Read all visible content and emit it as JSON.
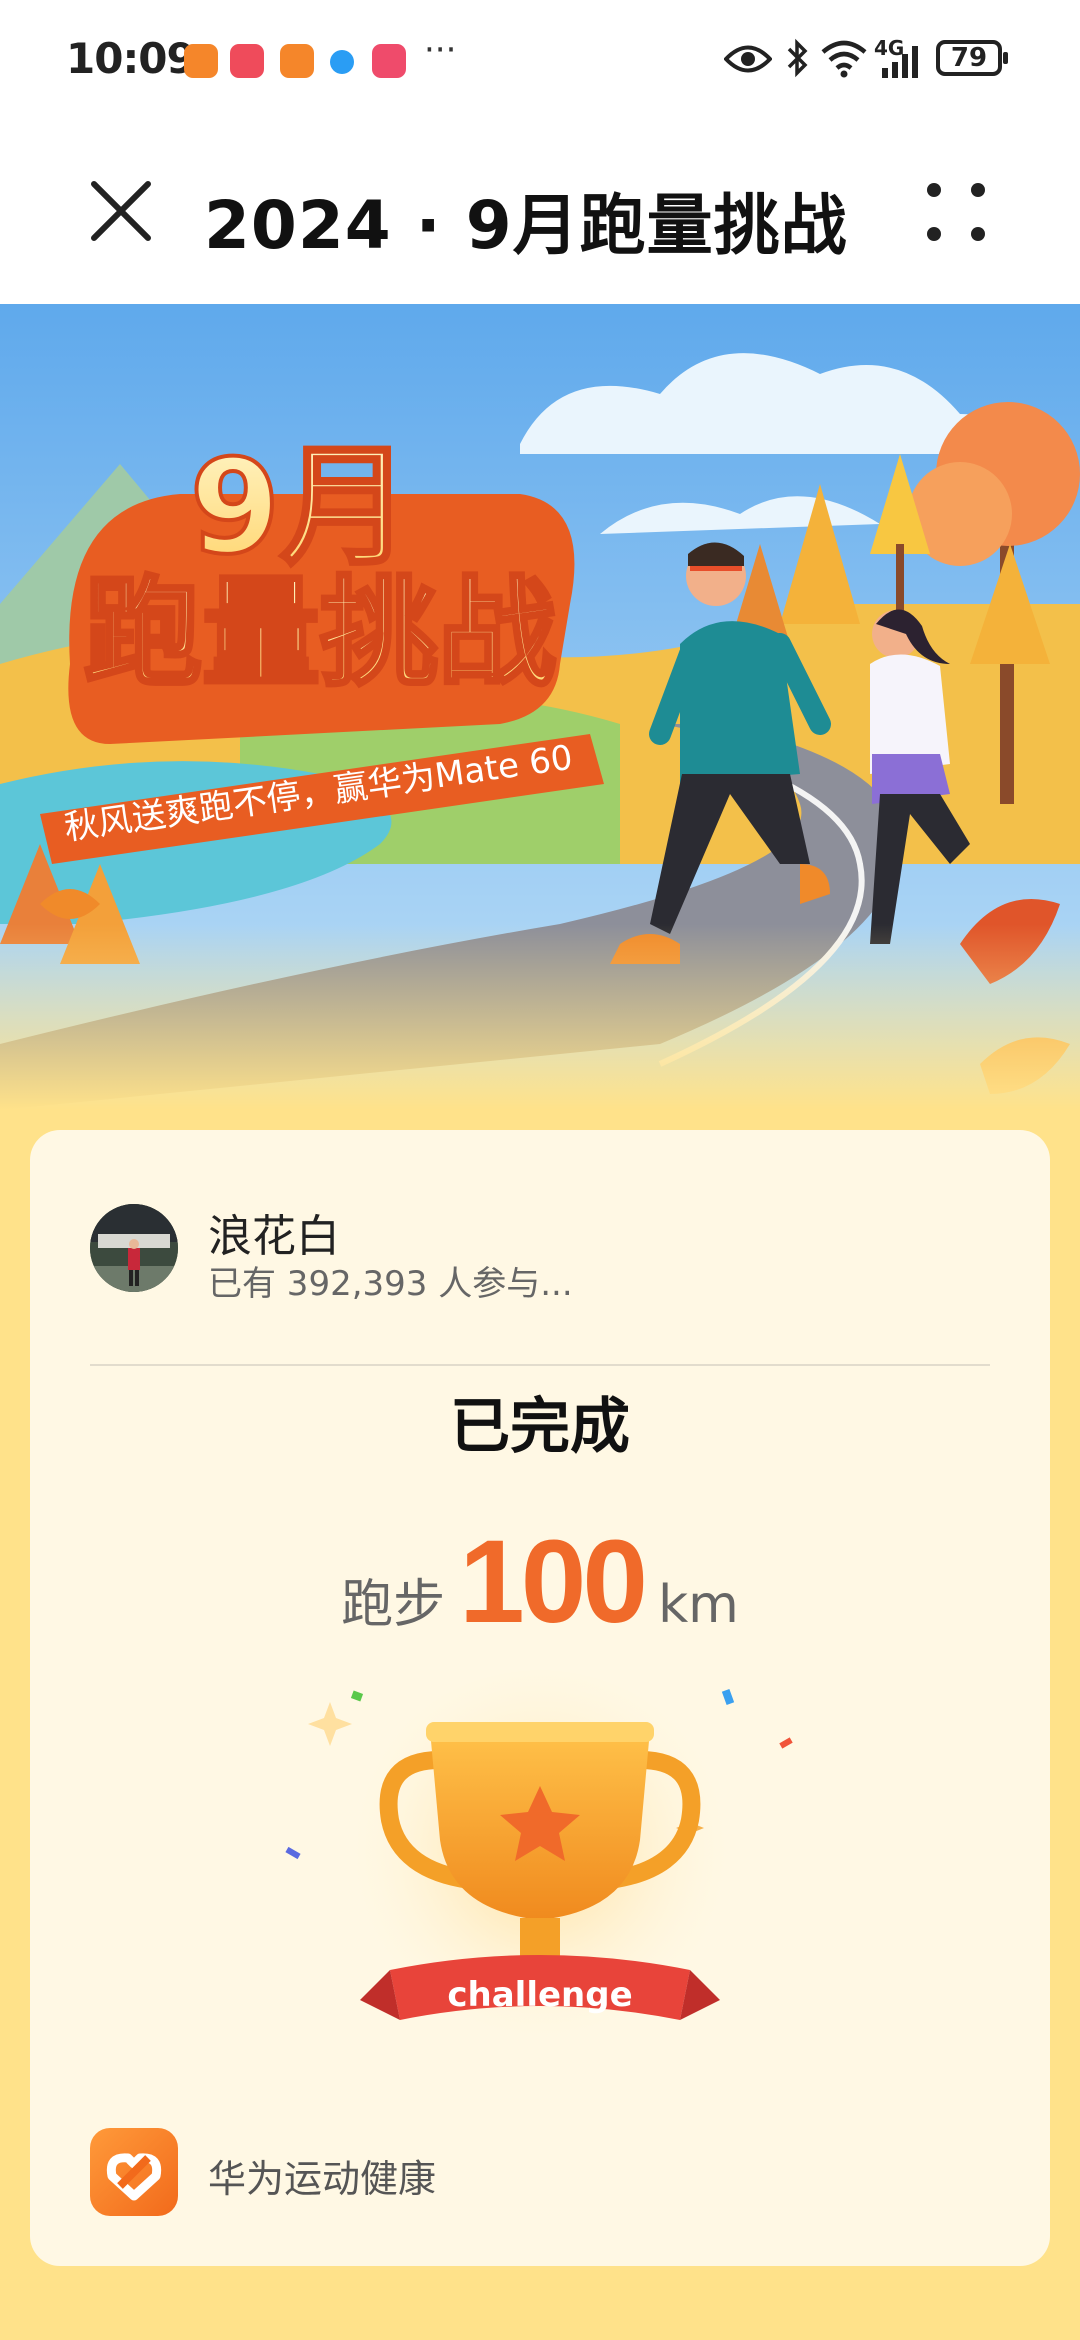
{
  "status_bar": {
    "time": "10:09",
    "notification_icons": [
      "huawei-health-icon",
      "huawei-app-icon",
      "huawei-health-icon",
      "browser-icon",
      "gallery-icon"
    ],
    "more": "···",
    "network": "4G",
    "battery": "79"
  },
  "header": {
    "title": "2024 · 9月跑量挑战"
  },
  "banner": {
    "headline_line1": "9月",
    "headline_line2": "跑量挑战",
    "slogan": "秋风送爽跑不停，赢华为Mate 60"
  },
  "card": {
    "user_name": "浪花白",
    "participants": "已有 392,393 人参与...",
    "status": "已完成",
    "distance_label": "跑步",
    "distance_value": "100",
    "distance_unit": "km",
    "badge_text": "challenge",
    "app_name": "华为运动健康"
  },
  "colors": {
    "accent": "#f06a2a",
    "page_background": "#ffe28a",
    "card_background": "#fff8e4"
  }
}
